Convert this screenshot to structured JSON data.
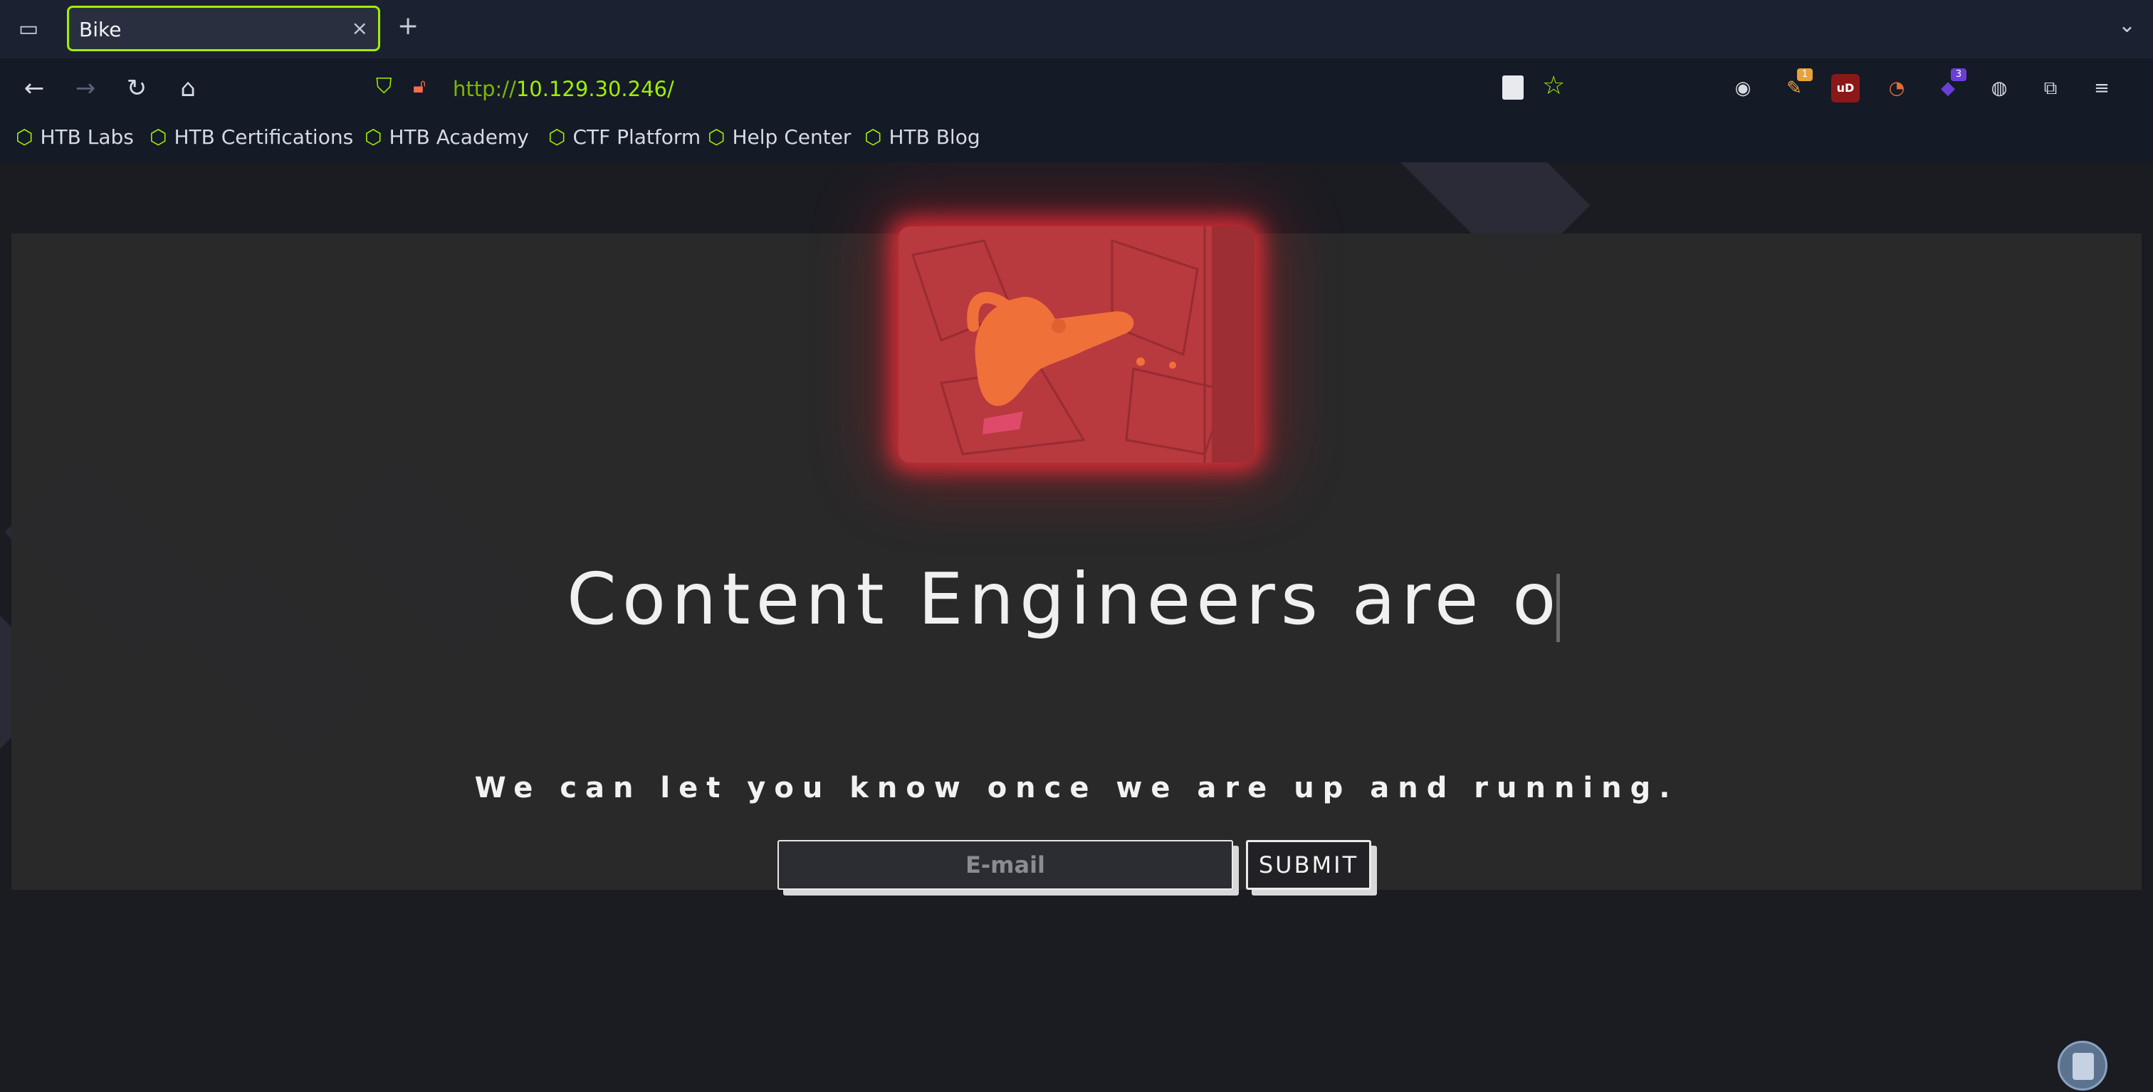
{
  "browser": {
    "tab": {
      "title": "Bike",
      "close": "×"
    },
    "new_tab": "+",
    "tab_list_icon": "▭",
    "tabs_menu_icon": "⌄",
    "nav": {
      "back": "←",
      "forward": "→",
      "reload": "↻",
      "home": "⌂"
    },
    "url": {
      "scheme": "http://",
      "host": "10.129.30.246/"
    },
    "icons": {
      "shield": "shield-icon",
      "lock": "insecure-lock-icon",
      "star": "bookmark-star-icon"
    },
    "extensions": [
      {
        "name": "account-icon",
        "glyph": "◉",
        "badge": ""
      },
      {
        "name": "extension-orange-icon",
        "glyph": "✎",
        "badge": "1"
      },
      {
        "name": "ublock-origin-icon",
        "glyph": "uD",
        "badge": ""
      },
      {
        "name": "extension-blocker-icon",
        "glyph": "◔",
        "badge": ""
      },
      {
        "name": "extension-purple-icon",
        "glyph": "◆",
        "badge": "3"
      },
      {
        "name": "cookie-icon",
        "glyph": "◍",
        "badge": ""
      },
      {
        "name": "extensions-puzzle-icon",
        "glyph": "⧉",
        "badge": ""
      },
      {
        "name": "app-menu-icon",
        "glyph": "≡",
        "badge": ""
      }
    ],
    "bookmarks": [
      "HTB Labs",
      "HTB Certifications",
      "HTB Academy",
      "CTF Platform",
      "Help Center",
      "HTB Blog"
    ]
  },
  "page": {
    "headline": "Content Engineers are o",
    "subtitle": "We can let you know once we are up and running.",
    "email_placeholder": "E-mail",
    "submit_label": "SUBMIT"
  },
  "colors": {
    "accent": "#9fef00",
    "glow": "#ff3240",
    "panel": "#2a2a2b"
  }
}
